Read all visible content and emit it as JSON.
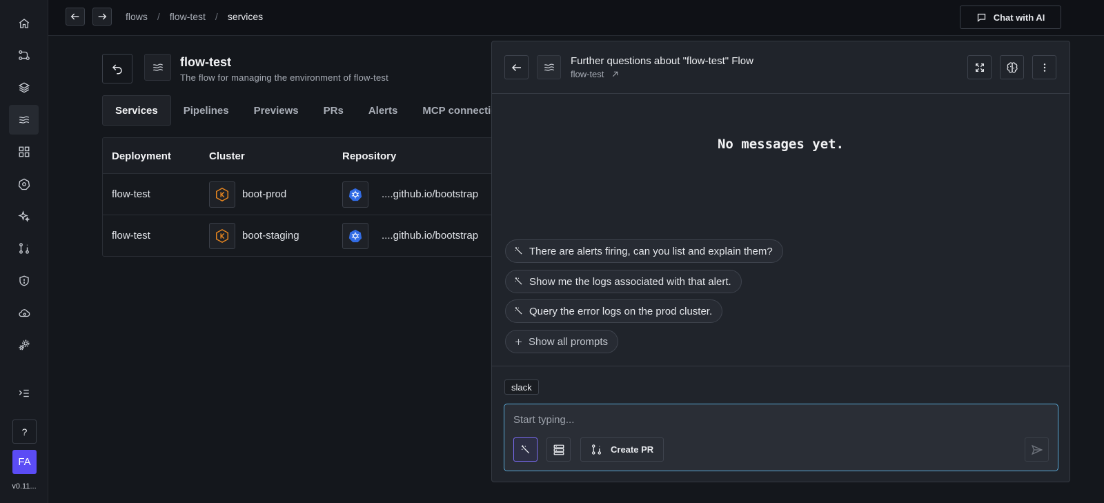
{
  "sidebar": {
    "items": [
      {
        "icon": "home-icon"
      },
      {
        "icon": "git-commit-icon"
      },
      {
        "icon": "layers-icon"
      },
      {
        "icon": "flows-icon",
        "active": true
      },
      {
        "icon": "catalog-icon"
      },
      {
        "icon": "kubernetes-icon"
      },
      {
        "icon": "ai-sparkle-icon"
      },
      {
        "icon": "pull-request-icon"
      },
      {
        "icon": "security-icon"
      },
      {
        "icon": "cloud-settings-icon"
      },
      {
        "icon": "settings-icon"
      },
      {
        "icon": "expand-menu-icon"
      }
    ],
    "help_label": "?",
    "avatar_initials": "FA",
    "version": "v0.11..."
  },
  "topbar": {
    "breadcrumbs": [
      "flows",
      "flow-test",
      "services"
    ],
    "separator": "/",
    "chat_button": "Chat with AI"
  },
  "flow": {
    "title": "flow-test",
    "description": "The flow for managing the environment of flow-test"
  },
  "tabs": [
    "Services",
    "Pipelines",
    "Previews",
    "PRs",
    "Alerts",
    "MCP connections"
  ],
  "table": {
    "headers": [
      "Deployment",
      "Cluster",
      "Repository"
    ],
    "rows": [
      {
        "deployment": "flow-test",
        "cluster": "boot-prod",
        "repository": "....github.io/bootstrap"
      },
      {
        "deployment": "flow-test",
        "cluster": "boot-staging",
        "repository": "....github.io/bootstrap"
      }
    ]
  },
  "chat": {
    "title": "Further questions about \"flow-test\" Flow",
    "subtitle": "flow-test",
    "empty_message": "No messages yet.",
    "prompts": [
      "There are alerts firing, can you list and explain them?",
      "Show me the logs associated with that alert.",
      "Query the error logs on the prod cluster."
    ],
    "show_all": "Show all prompts",
    "tag": "slack",
    "input_placeholder": "Start typing...",
    "input_value": "",
    "create_pr": "Create PR"
  },
  "colors": {
    "accent": "#5b4cf5",
    "input_focus": "#5aa9d6",
    "eks_orange": "#e8861f",
    "k8s_blue": "#326ce5"
  }
}
